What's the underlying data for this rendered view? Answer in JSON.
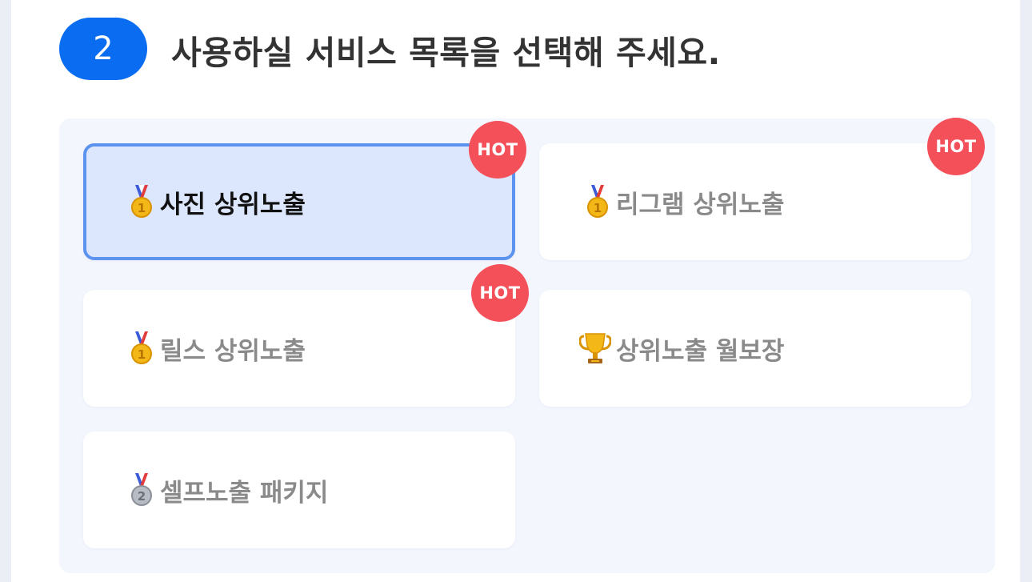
{
  "step": {
    "number": "2",
    "title": "사용하실 서비스 목록을 선택해 주세요."
  },
  "colors": {
    "accent": "#0a6cf0",
    "selected_border": "#5b93ee",
    "selected_bg": "#dce6fc",
    "hot": "#f4505a"
  },
  "options": [
    {
      "label": "사진 상위노출",
      "icon": "gold-medal-icon",
      "hot": "HOT",
      "selected": true
    },
    {
      "label": "리그램 상위노출",
      "icon": "gold-medal-icon",
      "hot": "HOT",
      "selected": false
    },
    {
      "label": "릴스 상위노출",
      "icon": "gold-medal-icon",
      "hot": "HOT",
      "selected": false
    },
    {
      "label": "상위노출 월보장",
      "icon": "trophy-icon",
      "hot": "",
      "selected": false
    },
    {
      "label": "셀프노출 패키지",
      "icon": "silver-medal-icon",
      "hot": "",
      "selected": false
    }
  ]
}
